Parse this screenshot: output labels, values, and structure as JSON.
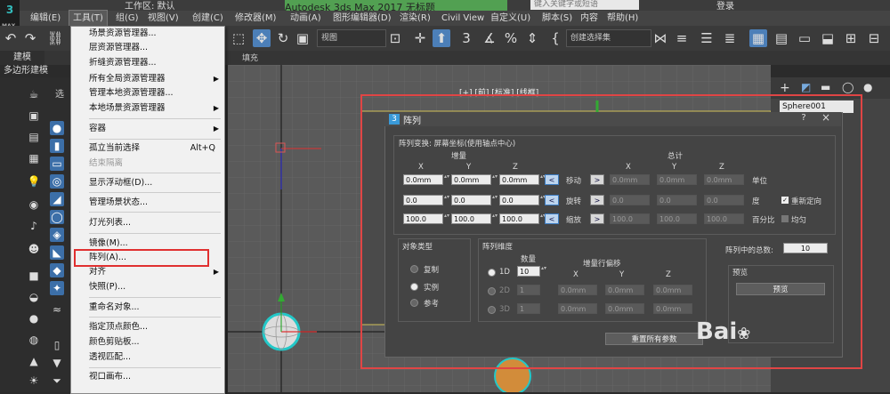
{
  "titlebar": {
    "workspace": "工作区: 默认",
    "app_title": "Autodesk 3ds Max 2017",
    "file_name": "无标题",
    "search_placeholder": "键入关键字或短语",
    "login": "登录"
  },
  "logo": {
    "text": "3",
    "sub": "MAX"
  },
  "menubar": {
    "items": [
      "编辑(E)",
      "工具(T)",
      "组(G)",
      "视图(V)",
      "创建(C)",
      "修改器(M)",
      "动画(A)",
      "图形编辑器(D)",
      "渲染(R)",
      "Civil View",
      "自定义(U)",
      "脚本(S)",
      "内容",
      "帮助(H)"
    ]
  },
  "toolbar": {
    "view_select": "视图",
    "selection_set": "创建选择集"
  },
  "ribbon": {
    "tab": "建模",
    "sub": "多边形建模",
    "fill": "填充"
  },
  "left_panel": {
    "stub": "选"
  },
  "viewport": {
    "label": "[+] [前] [标准] [线框]"
  },
  "right_panel": {
    "object_name": "Sphere001"
  },
  "tools_menu": {
    "items": [
      {
        "label": "场景资源管理器...",
        "shortcut": "",
        "submenu": false,
        "disabled": false
      },
      {
        "label": "层资源管理器...",
        "shortcut": "",
        "submenu": false,
        "disabled": false
      },
      {
        "label": "折缝资源管理器...",
        "shortcut": "",
        "submenu": false,
        "disabled": false
      },
      {
        "label": "所有全局资源管理器",
        "shortcut": "",
        "submenu": true,
        "disabled": false
      },
      {
        "label": "管理本地资源管理器...",
        "shortcut": "",
        "submenu": false,
        "disabled": false
      },
      {
        "label": "本地场景资源管理器",
        "shortcut": "",
        "submenu": true,
        "disabled": false
      },
      {
        "label": "容器",
        "shortcut": "",
        "submenu": true,
        "disabled": false
      },
      {
        "label": "孤立当前选择",
        "shortcut": "Alt+Q",
        "submenu": false,
        "disabled": false
      },
      {
        "label": "结束隔离",
        "shortcut": "",
        "submenu": false,
        "disabled": true
      },
      {
        "label": "显示浮动框(D)...",
        "shortcut": "",
        "submenu": false,
        "disabled": false
      },
      {
        "label": "管理场景状态...",
        "shortcut": "",
        "submenu": false,
        "disabled": false
      },
      {
        "label": "灯光列表...",
        "shortcut": "",
        "submenu": false,
        "disabled": false
      },
      {
        "label": "镜像(M)...",
        "shortcut": "",
        "submenu": false,
        "disabled": false
      },
      {
        "label": "阵列(A)...",
        "shortcut": "",
        "submenu": false,
        "disabled": false
      },
      {
        "label": "对齐",
        "shortcut": "",
        "submenu": true,
        "disabled": false
      },
      {
        "label": "快照(P)...",
        "shortcut": "",
        "submenu": false,
        "disabled": false
      },
      {
        "label": "重命名对象...",
        "shortcut": "",
        "submenu": false,
        "disabled": false
      },
      {
        "label": "指定顶点颜色...",
        "shortcut": "",
        "submenu": false,
        "disabled": false
      },
      {
        "label": "颜色剪贴板...",
        "shortcut": "",
        "submenu": false,
        "disabled": false
      },
      {
        "label": "透视匹配...",
        "shortcut": "",
        "submenu": false,
        "disabled": false
      },
      {
        "label": "视口画布...",
        "shortcut": "",
        "submenu": false,
        "disabled": false
      }
    ]
  },
  "dialog": {
    "title": "阵列",
    "help": "?",
    "close": "×",
    "transform_header": "阵列变换: 屏幕坐标(使用轴点中心)",
    "increment_label": "增量",
    "totals_label": "总计",
    "axis_x": "X",
    "axis_y": "Y",
    "axis_z": "Z",
    "rows": [
      {
        "name": "移动",
        "inc": [
          "0.0mm",
          "0.0mm",
          "0.0mm"
        ],
        "tot": [
          "0.0mm",
          "0.0mm",
          "0.0mm"
        ],
        "unit": "单位"
      },
      {
        "name": "旋转",
        "inc": [
          "0.0",
          "0.0",
          "0.0"
        ],
        "tot": [
          "0.0",
          "0.0",
          "0.0"
        ],
        "unit": "度"
      },
      {
        "name": "缩放",
        "inc": [
          "100.0",
          "100.0",
          "100.0"
        ],
        "tot": [
          "100.0",
          "100.0",
          "100.0"
        ],
        "unit": "百分比"
      }
    ],
    "reorient": "重新定向",
    "uniform": "均匀",
    "object_type": {
      "title": "对象类型",
      "options": [
        "复制",
        "实例",
        "参考"
      ],
      "selected": "实例"
    },
    "dimensions": {
      "title": "阵列维度",
      "count_label": "数量",
      "offset_label": "增量行偏移",
      "rows": [
        {
          "dim": "1D",
          "count": "10",
          "x": "",
          "y": "",
          "z": ""
        },
        {
          "dim": "2D",
          "count": "1",
          "x": "0.0mm",
          "y": "0.0mm",
          "z": "0.0mm"
        },
        {
          "dim": "3D",
          "count": "1",
          "x": "0.0mm",
          "y": "0.0mm",
          "z": "0.0mm"
        }
      ]
    },
    "total_label": "阵列中的总数:",
    "total_value": "10",
    "preview_group": "预览",
    "preview_button": "预览",
    "reset_button": "重置所有参数"
  },
  "watermark": "Bai"
}
